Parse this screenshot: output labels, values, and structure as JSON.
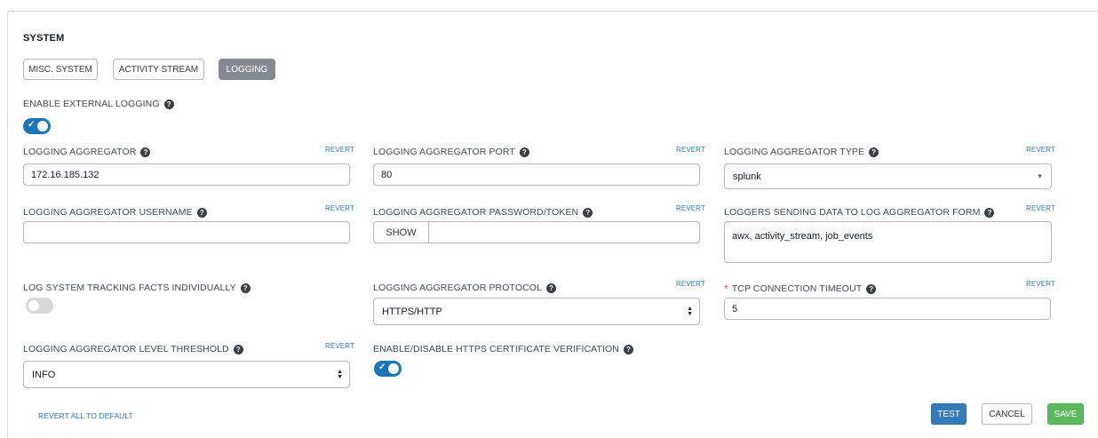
{
  "section_title": "SYSTEM",
  "tabs": [
    {
      "label": "MISC. SYSTEM",
      "active": false
    },
    {
      "label": "ACTIVITY STREAM",
      "active": false
    },
    {
      "label": "LOGGING",
      "active": true
    }
  ],
  "help_icon": "question-circle-icon",
  "revert_label": "REVERT",
  "enable_external_logging": {
    "label": "ENABLE EXTERNAL LOGGING",
    "value": true
  },
  "aggregator": {
    "label": "LOGGING AGGREGATOR",
    "value": "172.16.185.132"
  },
  "aggregator_port": {
    "label": "LOGGING AGGREGATOR PORT",
    "value": "80"
  },
  "aggregator_type": {
    "label": "LOGGING AGGREGATOR TYPE",
    "value": "splunk"
  },
  "aggregator_username": {
    "label": "LOGGING AGGREGATOR USERNAME",
    "value": ""
  },
  "aggregator_password": {
    "label": "LOGGING AGGREGATOR PASSWORD/TOKEN",
    "show_label": "SHOW",
    "value": ""
  },
  "loggers": {
    "label": "LOGGERS SENDING DATA TO LOG AGGREGATOR FORM",
    "value": "awx, activity_stream, job_events"
  },
  "tracking_facts": {
    "label": "LOG SYSTEM TRACKING FACTS INDIVIDUALLY",
    "value": false
  },
  "protocol": {
    "label": "LOGGING AGGREGATOR PROTOCOL",
    "value": "HTTPS/HTTP"
  },
  "tcp_timeout": {
    "label": "TCP CONNECTION TIMEOUT",
    "required_mark": "*",
    "value": "5"
  },
  "level_threshold": {
    "label": "LOGGING AGGREGATOR LEVEL THRESHOLD",
    "value": "INFO"
  },
  "cert_verification": {
    "label": "ENABLE/DISABLE HTTPS CERTIFICATE VERIFICATION",
    "value": true
  },
  "footer": {
    "revert_all": "REVERT ALL TO DEFAULT",
    "test": "TEST",
    "cancel": "CANCEL",
    "save": "SAVE"
  },
  "colors": {
    "primary": "#337ab7",
    "toggle_on": "#1d75b3",
    "save": "#5cb85c",
    "active_tab": "#848992",
    "required": "#d9534f"
  }
}
